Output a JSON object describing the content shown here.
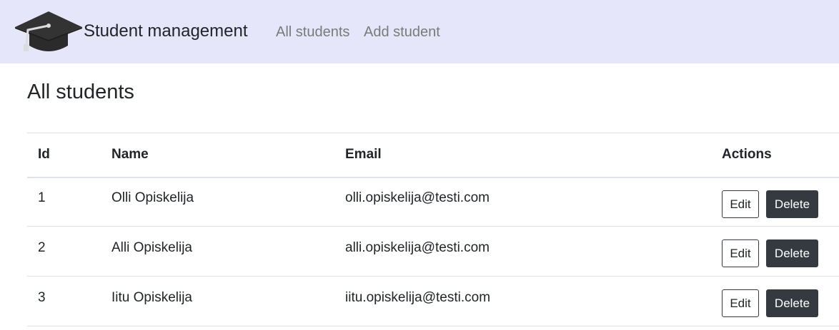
{
  "navbar": {
    "brand": "Student management",
    "logo_icon": "graduation-cap-icon",
    "links": [
      "All students",
      "Add student"
    ],
    "background": "#e6e6fa"
  },
  "page": {
    "title": "All students"
  },
  "table": {
    "headers": [
      "Id",
      "Name",
      "Email",
      "Actions"
    ],
    "rows": [
      {
        "id": "1",
        "name": "Olli Opiskelija",
        "email": "olli.opiskelija@testi.com",
        "edit": "Edit",
        "delete": "Delete"
      },
      {
        "id": "2",
        "name": "Alli Opiskelija",
        "email": "alli.opiskelija@testi.com",
        "edit": "Edit",
        "delete": "Delete"
      },
      {
        "id": "3",
        "name": "Iitu Opiskelija",
        "email": "iitu.opiskelija@testi.com",
        "edit": "Edit",
        "delete": "Delete"
      }
    ]
  },
  "colors": {
    "dark_button": "#343a40",
    "link_muted": "#7a7a7a"
  }
}
